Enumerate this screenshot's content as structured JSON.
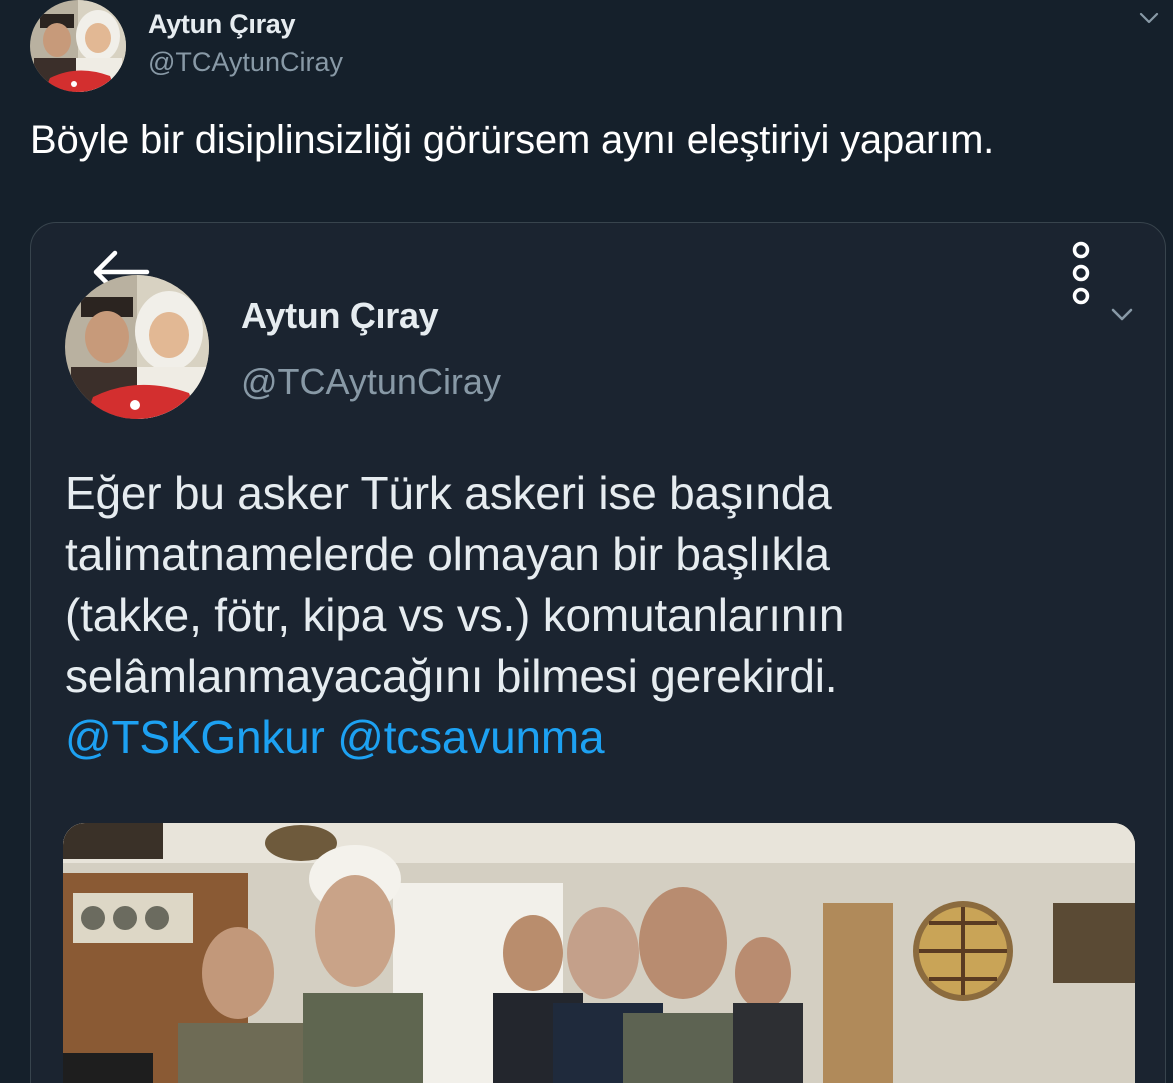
{
  "tweet": {
    "author_name": "Aytun Çıray",
    "author_handle": "@TCAytunCiray",
    "text": "Böyle bir disiplinsizliği görürsem aynı eleştiriyi yaparım."
  },
  "quoted_screenshot": {
    "author_name": "Aytun Çıray",
    "author_handle": "@TCAytunCiray",
    "body_lines": [
      "Eğer bu asker Türk askeri ise başında",
      "talimatnamelerde olmayan bir başlıkla",
      "(takke, fötr, kipa vs vs.) komutanlarının",
      "selâmlanmayacağını bilmesi gerekirdi."
    ],
    "mentions": [
      "@TSKGnkur",
      "@tcsavunma"
    ]
  },
  "icons": {
    "outer_caret": "chevron-down-icon",
    "back": "arrow-left-icon",
    "more": "vertical-dots-icon",
    "inner_caret": "chevron-down-icon"
  },
  "colors": {
    "background": "#15202b",
    "text": "#ffffff",
    "secondary": "#8899a6",
    "link": "#1da1f2",
    "card_border": "#38444d"
  }
}
